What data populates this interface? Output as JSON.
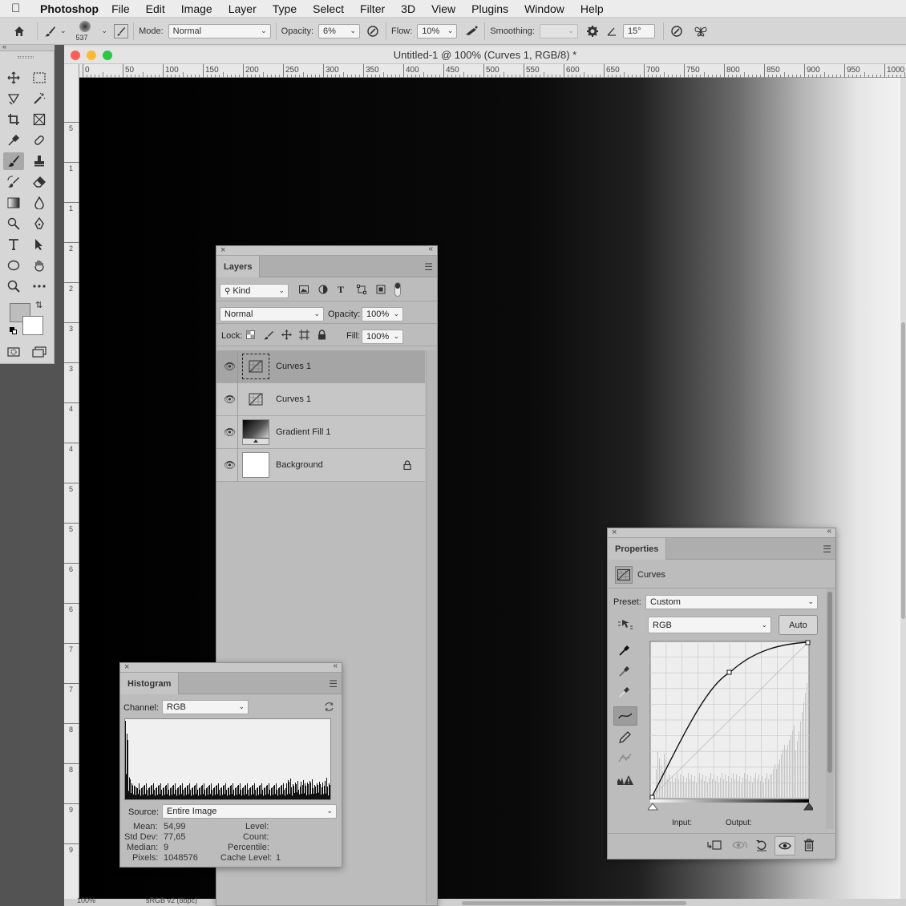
{
  "menubar": {
    "app": "Photoshop",
    "items": [
      "File",
      "Edit",
      "Image",
      "Layer",
      "Type",
      "Select",
      "Filter",
      "3D",
      "View",
      "Plugins",
      "Window",
      "Help"
    ]
  },
  "options": {
    "brush_size": "537",
    "mode_label": "Mode:",
    "mode_value": "Normal",
    "opacity_label": "Opacity:",
    "opacity_value": "6%",
    "flow_label": "Flow:",
    "flow_value": "10%",
    "smoothing_label": "Smoothing:",
    "smoothing_value": "",
    "angle_value": "15°"
  },
  "document": {
    "title": "Untitled-1 @ 100% (Curves 1, RGB/8) *",
    "ruler_top": [
      "0",
      "50",
      "100",
      "150",
      "200",
      "250",
      "300",
      "350",
      "400",
      "450",
      "500",
      "550",
      "600",
      "650",
      "700",
      "750",
      "800",
      "850",
      "900",
      "950",
      "1000"
    ],
    "ruler_left": [
      "5",
      "1",
      "1",
      "2",
      "2",
      "3",
      "3",
      "4",
      "4",
      "5",
      "5",
      "6",
      "6",
      "7",
      "7",
      "8",
      "8",
      "9",
      "9"
    ],
    "status_zoom": "100%",
    "status_profile": "sRGB v2 (8bpc)"
  },
  "layers_panel": {
    "tab": "Layers",
    "kind_label": "Kind",
    "blend_mode": "Normal",
    "opacity_label": "Opacity:",
    "opacity_value": "100%",
    "lock_label": "Lock:",
    "fill_label": "Fill:",
    "fill_value": "100%",
    "layers": [
      {
        "name": "Curves 1",
        "selected": true
      },
      {
        "name": "Curves 1",
        "selected": false
      },
      {
        "name": "Gradient Fill 1",
        "selected": false
      },
      {
        "name": "Background",
        "selected": false,
        "locked": true
      }
    ]
  },
  "histogram_panel": {
    "tab": "Histogram",
    "channel_label": "Channel:",
    "channel_value": "RGB",
    "source_label": "Source:",
    "source_value": "Entire Image",
    "stats": {
      "mean_label": "Mean:",
      "mean": "54,99",
      "stddev_label": "Std Dev:",
      "stddev": "77,65",
      "median_label": "Median:",
      "median": "9",
      "pixels_label": "Pixels:",
      "pixels": "1048576",
      "level_label": "Level:",
      "level": "",
      "count_label": "Count:",
      "count": "",
      "percentile_label": "Percentile:",
      "percentile": "",
      "cache_label": "Cache Level:",
      "cache": "1"
    }
  },
  "properties_panel": {
    "tab": "Properties",
    "adjustment": "Curves",
    "preset_label": "Preset:",
    "preset_value": "Custom",
    "channel_value": "RGB",
    "auto_label": "Auto",
    "input_label": "Input:",
    "output_label": "Output:"
  },
  "colors": {
    "foreground": "#bdbdbd",
    "background": "#ffffff",
    "close_red": "#fe5f57",
    "min_yellow": "#febc2e",
    "max_green": "#28c840"
  }
}
